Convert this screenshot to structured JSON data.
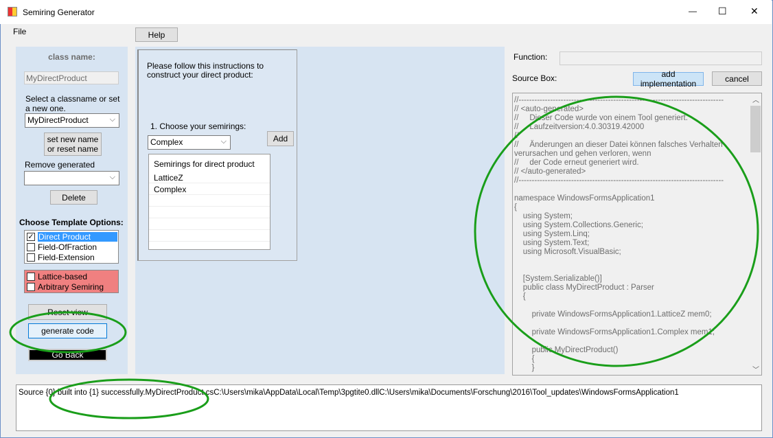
{
  "window": {
    "title": "Semiring Generator",
    "minimize": "—",
    "maximize": "☐",
    "close": "✕"
  },
  "menu": {
    "file": "File",
    "help": "Help"
  },
  "left": {
    "class_name_label": "class name:",
    "class_name_value": "MyDirectProduct",
    "select_hint": "Select a classname or set a new one.",
    "class_combo": "MyDirectProduct",
    "set_name_button": [
      "set new name",
      "or reset name"
    ],
    "remove_label": "Remove generated semiring:",
    "remove_combo": "",
    "delete_button": "Delete",
    "template_label": "Choose Template Options:",
    "templates": [
      {
        "label": "Direct Product",
        "checked": true
      },
      {
        "label": "Field-OfFraction",
        "checked": false
      },
      {
        "label": "Field-Extension",
        "checked": false
      }
    ],
    "extra_options": [
      {
        "label": "Lattice-based",
        "checked": false
      },
      {
        "label": "Arbitrary Semiring",
        "checked": false
      }
    ],
    "reset_view": "Reset view",
    "generate_code": "generate code",
    "go_back": "Go Back"
  },
  "middle": {
    "instructions": "Please follow this instructions to construct your direct product:",
    "step1": "1. Choose your semirings:",
    "semiring_combo": "Complex",
    "add_button": "Add",
    "list_header": "Semirings for direct product",
    "list_items": [
      "LatticeZ",
      "Complex"
    ]
  },
  "right": {
    "function_label": "Function:",
    "function_value": "",
    "source_label": "Source Box:",
    "add_impl": "add implementation",
    "cancel": "cancel",
    "source_code": "//------------------------------------------------------------------------------\n// <auto-generated>\n//     Dieser Code wurde von einem Tool generiert.\n//     Laufzeitversion:4.0.30319.42000\n//\n//     Änderungen an dieser Datei können falsches Verhalten verursachen und gehen verloren, wenn\n//     der Code erneut generiert wird.\n// </auto-generated>\n//------------------------------------------------------------------------------\n\nnamespace WindowsFormsApplication1\n{\n    using System;\n    using System.Collections.Generic;\n    using System.Linq;\n    using System.Text;\n    using Microsoft.VisualBasic;\n\n\n    [System.Serializable()]\n    public class MyDirectProduct : Parser\n    {\n\n        private WindowsFormsApplication1.LatticeZ mem0;\n\n        private WindowsFormsApplication1.Complex mem1;\n\n        public MyDirectProduct()\n        {\n        }"
  },
  "output": {
    "text": "Source {0} built into {1} successfully.MyDirectProduct.csC:\\Users\\mika\\AppData\\Local\\Temp\\3pgtite0.dllC:\\Users\\mika\\Documents\\Forschung\\2016\\Tool_updates\\WindowsFormsApplication1"
  },
  "colors": {
    "panel": "#d7e4f2",
    "selected": "#3399ff",
    "warning": "#f08080",
    "annotation": "#1a9e1a"
  }
}
